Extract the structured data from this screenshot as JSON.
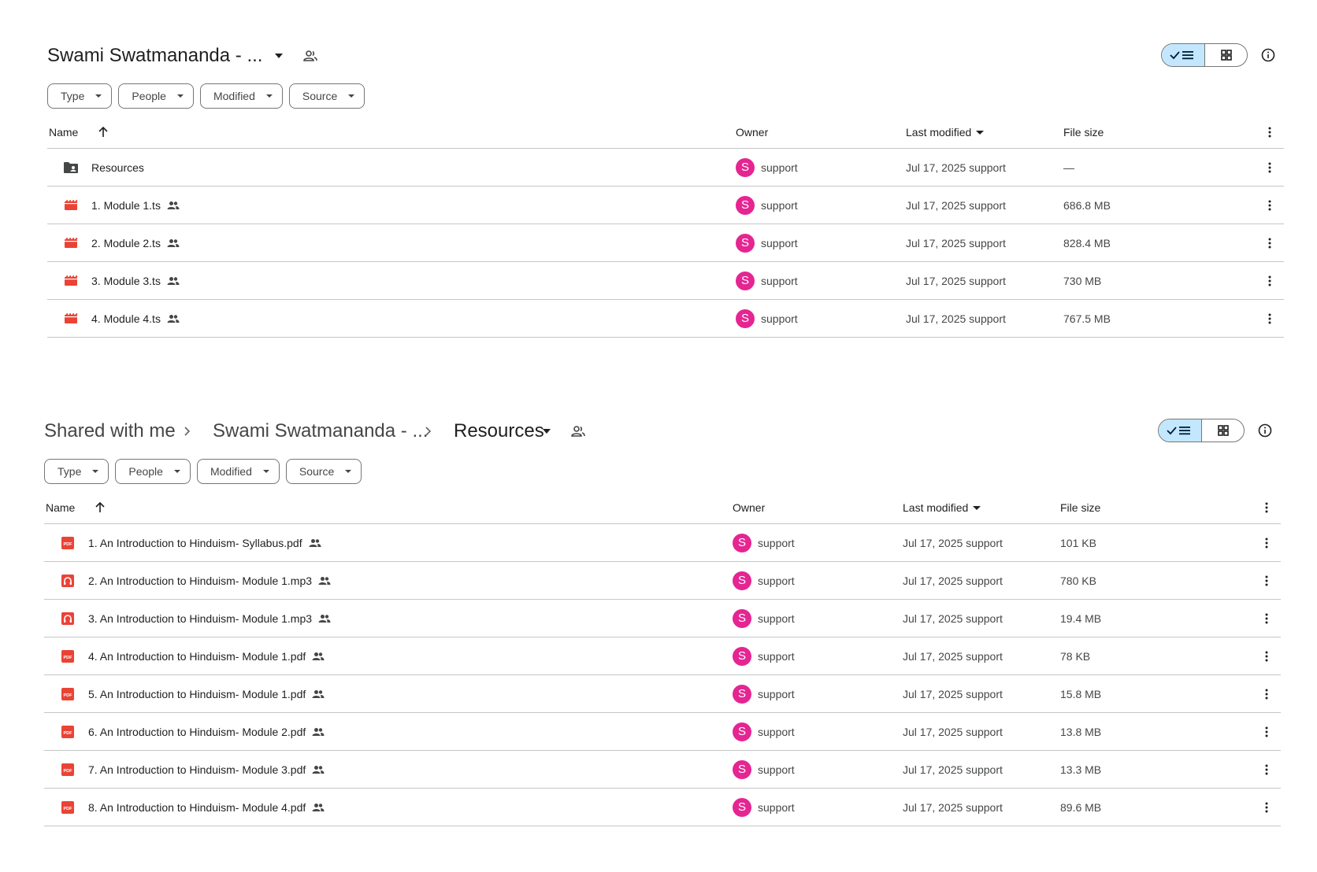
{
  "colors": {
    "accent_toggle": "#c2e7ff",
    "avatar": "#e52592",
    "video_icon": "#ea4335",
    "pdf_icon": "#ea4335",
    "audio_icon": "#ea4335"
  },
  "top_view": {
    "title": "Swami Swatmananda - ...",
    "filters": [
      "Type",
      "People",
      "Modified",
      "Source"
    ],
    "columns": {
      "name": "Name",
      "owner": "Owner",
      "modified": "Last modified",
      "size": "File size"
    },
    "rows": [
      {
        "icon": "shared-folder-icon",
        "name": "Resources",
        "owner_initial": "S",
        "owner": "support",
        "modified": "Jul 17, 2025 support",
        "size": "—",
        "shared": false
      },
      {
        "icon": "video-file-icon",
        "name": "1. Module 1.ts",
        "owner_initial": "S",
        "owner": "support",
        "modified": "Jul 17, 2025 support",
        "size": "686.8 MB",
        "shared": true
      },
      {
        "icon": "video-file-icon",
        "name": "2. Module 2.ts",
        "owner_initial": "S",
        "owner": "support",
        "modified": "Jul 17, 2025 support",
        "size": "828.4 MB",
        "shared": true
      },
      {
        "icon": "video-file-icon",
        "name": "3. Module 3.ts",
        "owner_initial": "S",
        "owner": "support",
        "modified": "Jul 17, 2025 support",
        "size": "730 MB",
        "shared": true
      },
      {
        "icon": "video-file-icon",
        "name": "4. Module 4.ts",
        "owner_initial": "S",
        "owner": "support",
        "modified": "Jul 17, 2025 support",
        "size": "767.5 MB",
        "shared": true
      }
    ]
  },
  "bottom_view": {
    "breadcrumb": [
      "Shared with me",
      "Swami Swatmananda - ...",
      "Resources"
    ],
    "filters": [
      "Type",
      "People",
      "Modified",
      "Source"
    ],
    "columns": {
      "name": "Name",
      "owner": "Owner",
      "modified": "Last modified",
      "size": "File size"
    },
    "rows": [
      {
        "icon": "pdf-file-icon",
        "name": "1. An Introduction to Hinduism- Syllabus.pdf",
        "owner_initial": "S",
        "owner": "support",
        "modified": "Jul 17, 2025 support",
        "size": "101 KB",
        "shared": true
      },
      {
        "icon": "audio-file-icon",
        "name": "2. An Introduction to Hinduism- Module 1.mp3",
        "owner_initial": "S",
        "owner": "support",
        "modified": "Jul 17, 2025 support",
        "size": "780 KB",
        "shared": true
      },
      {
        "icon": "audio-file-icon",
        "name": "3. An Introduction to Hinduism- Module 1.mp3",
        "owner_initial": "S",
        "owner": "support",
        "modified": "Jul 17, 2025 support",
        "size": "19.4 MB",
        "shared": true
      },
      {
        "icon": "pdf-file-icon",
        "name": "4. An Introduction to Hinduism- Module 1.pdf",
        "owner_initial": "S",
        "owner": "support",
        "modified": "Jul 17, 2025 support",
        "size": "78 KB",
        "shared": true
      },
      {
        "icon": "pdf-file-icon",
        "name": "5. An Introduction to Hinduism- Module 1.pdf",
        "owner_initial": "S",
        "owner": "support",
        "modified": "Jul 17, 2025 support",
        "size": "15.8 MB",
        "shared": true
      },
      {
        "icon": "pdf-file-icon",
        "name": "6. An Introduction to Hinduism- Module 2.pdf",
        "owner_initial": "S",
        "owner": "support",
        "modified": "Jul 17, 2025 support",
        "size": "13.8 MB",
        "shared": true
      },
      {
        "icon": "pdf-file-icon",
        "name": "7. An Introduction to Hinduism- Module 3.pdf",
        "owner_initial": "S",
        "owner": "support",
        "modified": "Jul 17, 2025 support",
        "size": "13.3 MB",
        "shared": true
      },
      {
        "icon": "pdf-file-icon",
        "name": "8. An Introduction to Hinduism- Module 4.pdf",
        "owner_initial": "S",
        "owner": "support",
        "modified": "Jul 17, 2025 support",
        "size": "89.6 MB",
        "shared": true
      }
    ]
  }
}
